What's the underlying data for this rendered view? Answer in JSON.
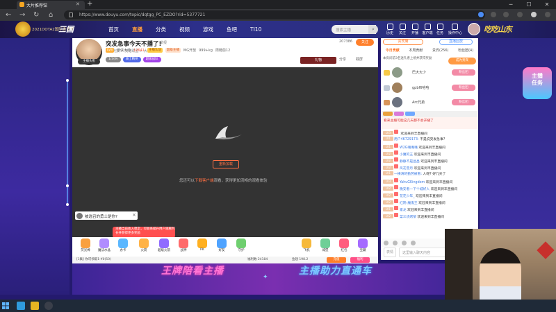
{
  "browser": {
    "tab_title": "大片推荐馆",
    "url": "https://www.douyu.com/topic/dqtgg_PC_EZDO?rid=5377721"
  },
  "site": {
    "logo_text": "2021DOTA2国际邀请赛",
    "logo_brand": "三国",
    "nav": [
      "首页",
      "直播",
      "分类",
      "视频",
      "游戏",
      "鱼吧",
      "TI10"
    ],
    "nav_active": "直播",
    "search_placeholder": "搜索主播",
    "header_icons": [
      "历史",
      "关注",
      "开播",
      "客户端",
      "任务",
      "操作中心"
    ],
    "brush_text": "吃吃山东"
  },
  "stream": {
    "title": "突发急事今天不播了!",
    "report": "举报",
    "category": "网游竞技 > 英雄联盟 > 大神教学",
    "level_badge": "LV8",
    "streamer_name": "游侠大帅",
    "hot": "12641",
    "badge_tags": [
      "主播认证",
      "超级主播"
    ],
    "meta_items": [
      "MG开放",
      "999+kg",
      "周榜前12"
    ],
    "fans": "207386",
    "follow": "关注",
    "buttons": [
      "分享",
      "截屏"
    ],
    "game_btn": "礼物",
    "sub_badges": [
      "1/3(9)",
      "骑士精英",
      "超级战队"
    ],
    "rank_tag": "主播头衔"
  },
  "video": {
    "refresh": "重新加载",
    "tip_prefix": "您还可以",
    "tip_highlight": "下载客户端",
    "tip_suffix": "观看，获得更加流畅的观看体验",
    "hero_prompt": "被选召的勇士是你?",
    "red_tip": "主播当前收入稳定，可联系提升用户观看时长并获得更多奖励"
  },
  "gifts": [
    "荧光棒",
    "魔法水晶",
    "办卡",
    "火箭",
    "超级火箭",
    "战神",
    "PK",
    "好友",
    "守护",
    "贵族",
    "粉丝牌",
    "盛典",
    "飞机",
    "城堡",
    "红包",
    "宝藏"
  ],
  "bottombar": {
    "left": "[1集] 你可领取1-¥0(50)",
    "mid": "福利数 24184",
    "right": "鱼翅 198.2",
    "btn1": "充值",
    "btn2": "福利"
  },
  "sidebar": {
    "tab_primary": "贵宾席",
    "tab_secondary": "直播回放",
    "rank_tabs": [
      "今日贡献",
      "本周贡献",
      "贵宾(256)",
      "粉丝团(4)"
    ],
    "rank_tab_active": "今日贡献",
    "rank_note": "本房间前3名送礼者上榜并获得奖励",
    "rank_sum": "成为贵宾",
    "ranks": [
      {
        "name": "巴大大少",
        "badge": "粉丝团"
      },
      {
        "name": "gpbf6哈哈",
        "badge": "粉丝团"
      },
      {
        "name": "Arc兄弟",
        "badge": "粉丝团"
      }
    ],
    "chat_notice": "看来主播可能这几天都不会开播了",
    "chat": [
      {
        "lv": "LV3",
        "user": "",
        "text": "欢迎来到丰直播间"
      },
      {
        "lv": "LV1",
        "user": "用户46729173:",
        "text": "不是说突发急事?"
      },
      {
        "lv": "LV1",
        "user": "W2G嘴嘴嘴",
        "text": "欢迎来到丰直播间"
      },
      {
        "lv": "LV2",
        "user": "小魔的王",
        "text": "欢迎来到丰直播间"
      },
      {
        "lv": "LV2",
        "user": "静静不是昌昌",
        "text": "欢迎来到丰直播间"
      },
      {
        "lv": "LV2",
        "user": "风花雪月",
        "text": "欢迎来到丰直播间"
      },
      {
        "lv": "LV1",
        "user": "一横滑的勤劳被看:",
        "text": "人呢? 好几天了"
      },
      {
        "lv": "LV3",
        "user": "YahuGKingdom",
        "text": "欢迎来到丰直播间"
      },
      {
        "lv": "LV2",
        "user": "晚安看一下个城好人",
        "text": "欢迎来到丰直播间"
      },
      {
        "lv": "LV2",
        "user": "花花少年_",
        "text": "欢迎来到丰直播间"
      },
      {
        "lv": "LV2",
        "user": "红鸦-魔鬼王",
        "text": "欢迎来到丰直播间"
      },
      {
        "lv": "LV1",
        "user": "家龙",
        "text": "欢迎来到丰直播间"
      },
      {
        "lv": "LV2",
        "user": "菜三烧烤架",
        "text": "欢迎来到丰直播间"
      }
    ],
    "chat_placeholder": "这里输入聊天内容",
    "send": "发送",
    "emoji": "表情"
  },
  "promo": {
    "line1": "主播",
    "line2": "任务"
  },
  "banner": {
    "left": "王牌陪看主播",
    "right": "主播助力直通车"
  },
  "colors": {
    "accent": "#ff7f2a",
    "page_bg": "#241a6e",
    "nav_active": "#ff9e3d"
  }
}
